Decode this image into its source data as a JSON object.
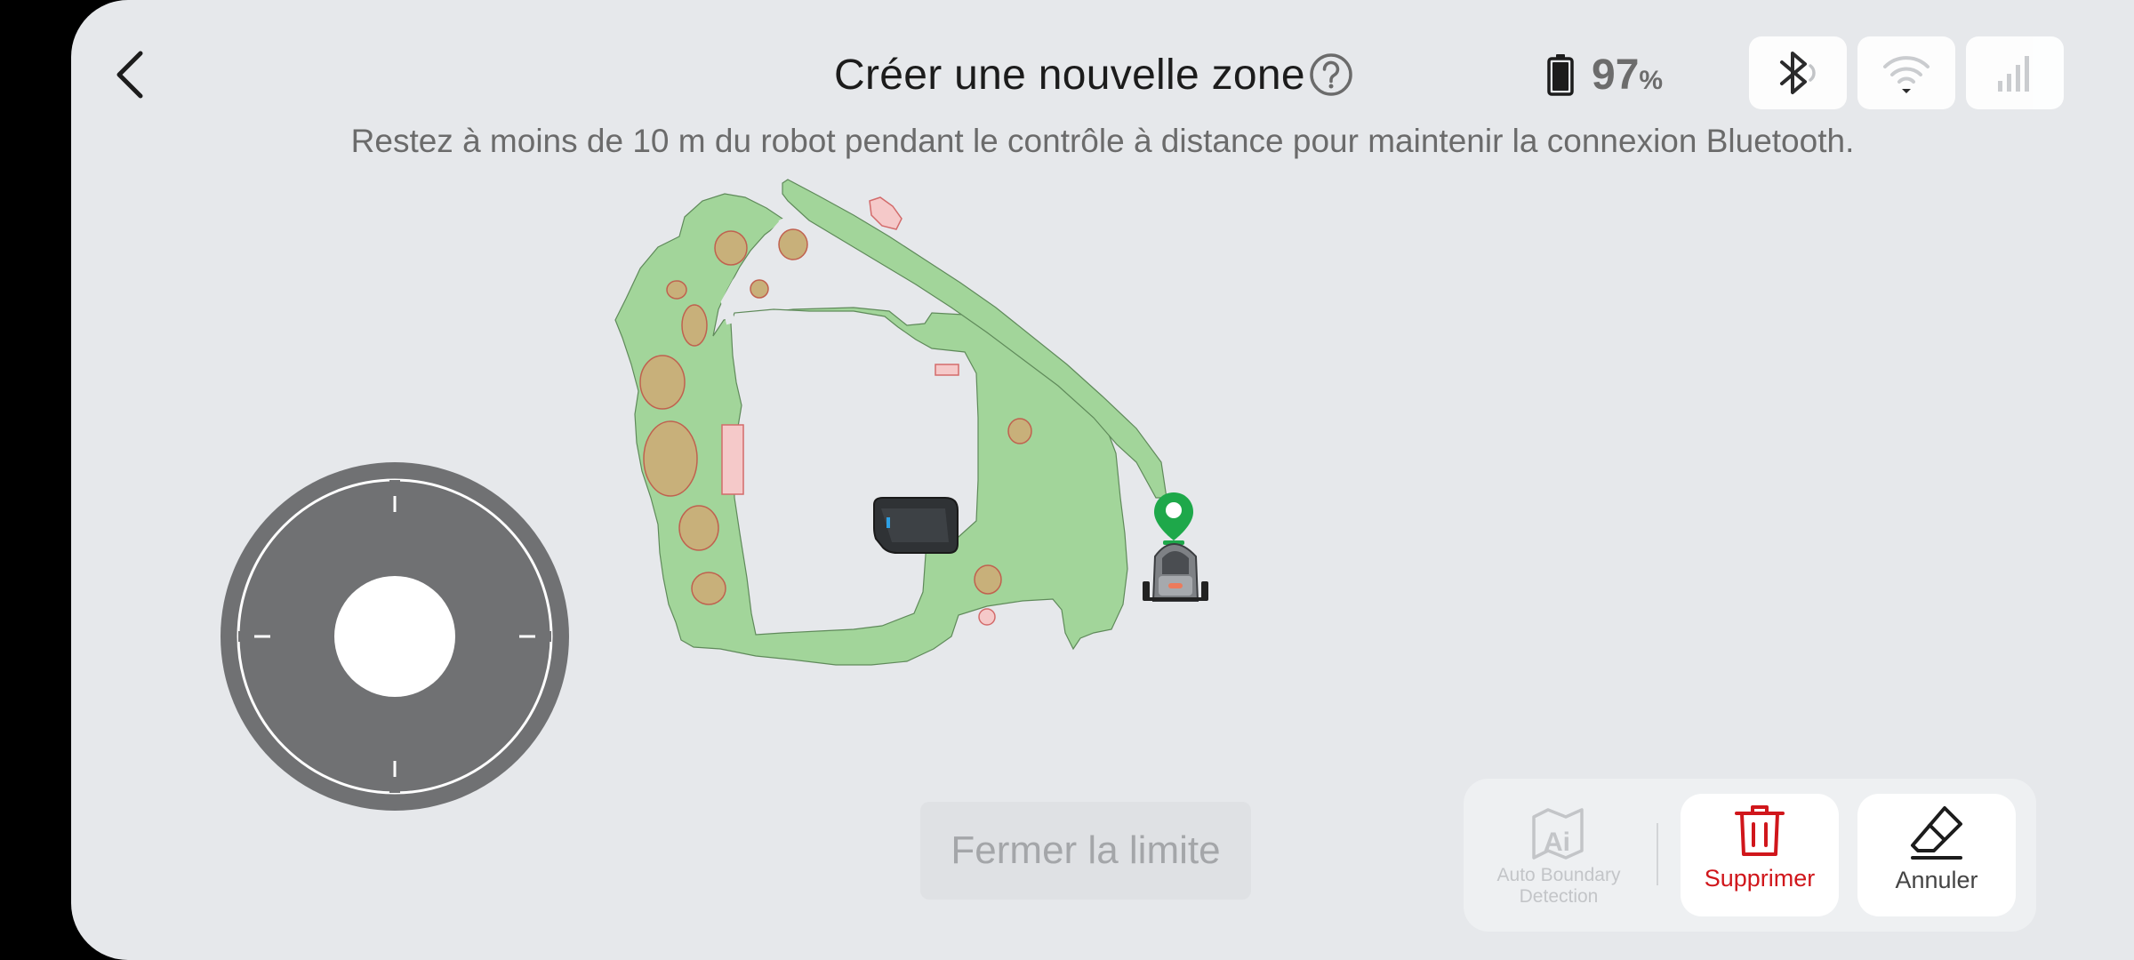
{
  "header": {
    "title": "Créer une nouvelle zone",
    "subtitle": "Restez à moins de 10 m du robot pendant le contrôle à distance pour maintenir la connexion Bluetooth."
  },
  "status": {
    "battery_value": "97",
    "battery_unit": "%",
    "bluetooth_icon": "bluetooth-connected-icon",
    "wifi_icon": "wifi-icon",
    "cellular_icon": "cellular-signal-icon"
  },
  "actions": {
    "close_boundary_label": "Fermer la limite",
    "auto_boundary_label_line1": "Auto Boundary",
    "auto_boundary_label_line2": "Detection",
    "delete_label": "Supprimer",
    "undo_label": "Annuler"
  },
  "colors": {
    "lawn": "#a2d59a",
    "obstacle": "#c8b07a",
    "no_go": "#f5c9c9",
    "delete": "#d0161b",
    "pin": "#1ea84a"
  }
}
